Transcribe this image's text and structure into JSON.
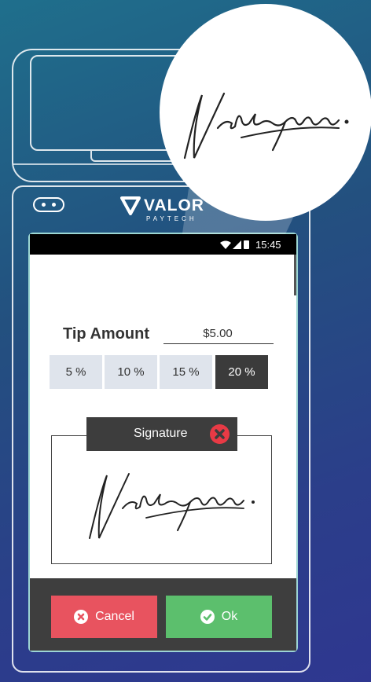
{
  "brand": {
    "name": "VALOR",
    "sub": "PAYTECH"
  },
  "status": {
    "time": "15:45"
  },
  "tip": {
    "label": "Tip Amount",
    "value": "$5.00",
    "options": [
      {
        "label": "5 %",
        "selected": false
      },
      {
        "label": "10 %",
        "selected": false
      },
      {
        "label": "15 %",
        "selected": false
      },
      {
        "label": "20 %",
        "selected": true
      }
    ]
  },
  "signature": {
    "title": "Signature"
  },
  "buttons": {
    "cancel": "Cancel",
    "ok": "Ok"
  },
  "colors": {
    "cancel": "#e8535f",
    "ok": "#5cbf6d",
    "close": "#e83a45",
    "selected": "#3b3b3b",
    "unselected": "#dfe4ec"
  }
}
